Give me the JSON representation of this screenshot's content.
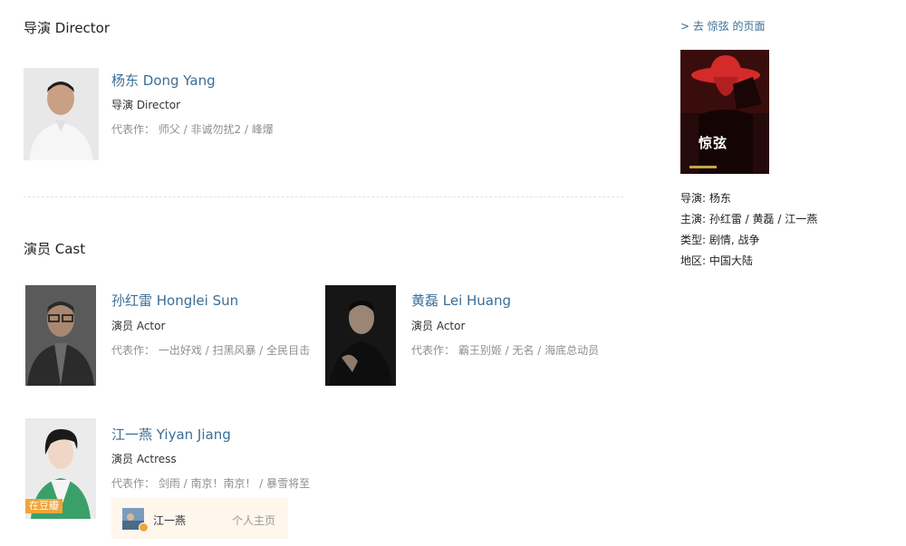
{
  "director_section": {
    "heading": "导演 Director",
    "person": {
      "name": "杨东 Dong Yang",
      "role": "导演 Director",
      "works": "代表作： 师父 / 非诚勿扰2 / 峰爆"
    }
  },
  "cast_section": {
    "heading": "演员 Cast",
    "people": [
      {
        "name": "孙红雷 Honglei Sun",
        "role": "演员 Actor",
        "works": "代表作： 一出好戏 / 扫黑风暴 / 全民目击"
      },
      {
        "name": "黄磊 Lei Huang",
        "role": "演员 Actor",
        "works": "代表作： 霸王别姬 / 无名 / 海底总动员"
      },
      {
        "name": "江一燕 Yiyan Jiang",
        "role": "演员 Actress",
        "works": "代表作： 剑雨 / 南京！南京！ / 暴雪将至",
        "badge": "在豆瓣"
      }
    ],
    "profile_card": {
      "name": "江一燕",
      "link": "个人主页"
    }
  },
  "sidebar": {
    "link": "> 去 惊弦 的页面",
    "poster_title": "惊弦",
    "info": [
      "导演: 杨东",
      "主演: 孙红雷 / 黄磊 / 江一燕",
      "类型: 剧情, 战争",
      "地区: 中国大陆"
    ]
  },
  "colors": {
    "link_blue": "#3a6e96",
    "badge_orange": "#f0a43a",
    "card_bg": "#fff6ec",
    "muted_text": "#8f8f8f"
  },
  "icons": [
    "person-photo",
    "movie-poster",
    "verified-badge-icon"
  ]
}
